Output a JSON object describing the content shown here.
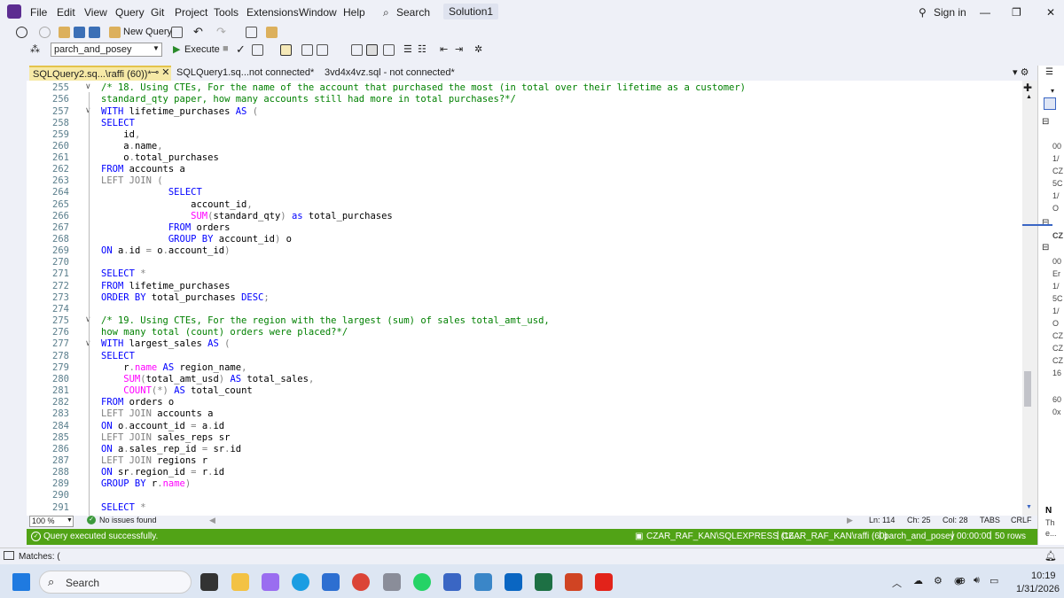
{
  "menu": [
    "File",
    "Edit",
    "View",
    "Query",
    "Git",
    "Project",
    "Tools",
    "Extensions",
    "Window",
    "Help"
  ],
  "search_label": "Search",
  "solution": "Solution1",
  "sign_in": "Sign in",
  "toolbar": {
    "new_query": "New Query",
    "database": "parch_and_posey",
    "execute": "Execute"
  },
  "tabs": [
    {
      "label": "SQLQuery2.sq...\\raffi (60))*",
      "active": true
    },
    {
      "label": "SQLQuery1.sq...not connected*",
      "active": false
    },
    {
      "label": "3vd4x4vz.sql - not connected*",
      "active": false
    }
  ],
  "line_numbers": [
    "255",
    "256",
    "257",
    "258",
    "259",
    "260",
    "261",
    "262",
    "263",
    "264",
    "265",
    "266",
    "267",
    "268",
    "269",
    "270",
    "271",
    "272",
    "273",
    "274",
    "275",
    "276",
    "277",
    "278",
    "279",
    "280",
    "281",
    "282",
    "283",
    "284",
    "285",
    "286",
    "287",
    "288",
    "289",
    "290",
    "291"
  ],
  "zoom": "100 %",
  "issues": "No issues found",
  "cursor": {
    "ln": "Ln: 114",
    "ch": "Ch: 25",
    "col": "Col: 28",
    "tabs": "TABS",
    "crlf": "CRLF"
  },
  "status": {
    "message": "Query executed successfully.",
    "server": "CZAR_RAF_KAN\\SQLEXPRESS (16...",
    "user": "CZAR_RAF_KAN\\raffi (60)",
    "db": "parch_and_posey",
    "time": "00:00:00",
    "rows": "50 rows"
  },
  "right_pane_texts": [
    "00",
    "1/",
    "CZ",
    "5C",
    "1/",
    "O",
    "CZ",
    "00",
    "Er",
    "1/",
    "5C",
    "1/",
    "O",
    "CZ",
    "CZ",
    "CZ",
    "16",
    "60",
    "0x",
    "N",
    "Th",
    "e..."
  ],
  "matches": "Matches: (",
  "taskbar": {
    "search": "Search",
    "time": "10:19",
    "date": "1/31/2026"
  }
}
